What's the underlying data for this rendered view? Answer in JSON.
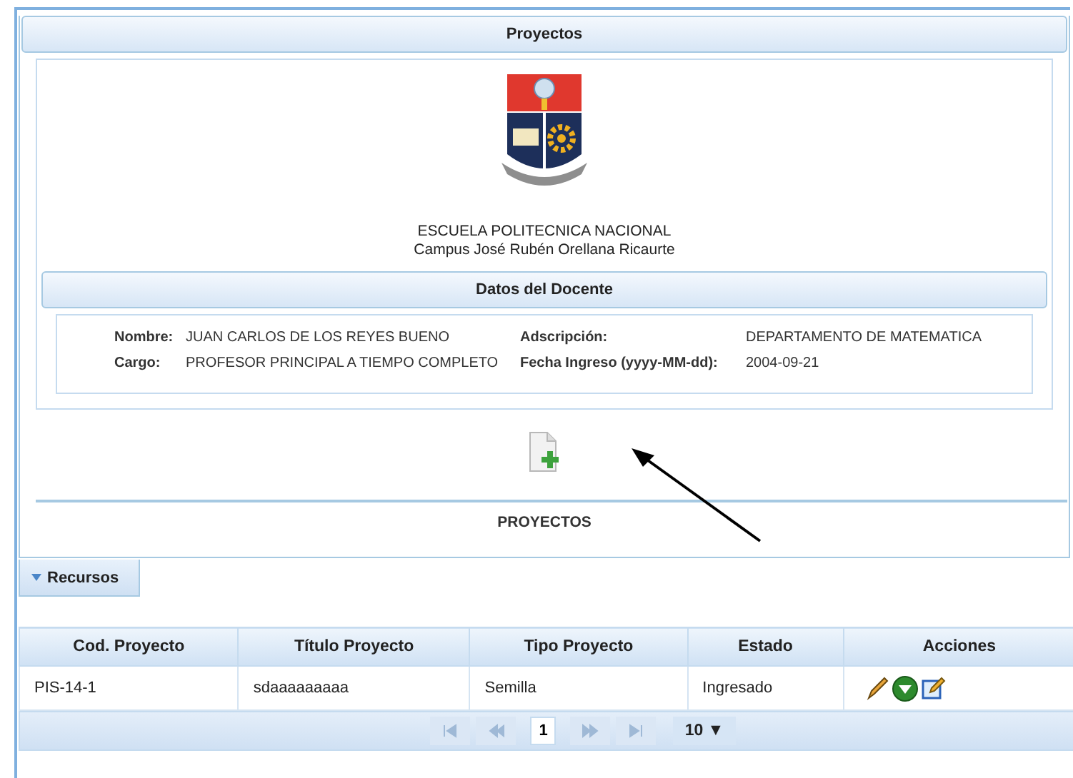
{
  "panel": {
    "title": "Proyectos"
  },
  "institution": {
    "name": "ESCUELA POLITECNICA NACIONAL",
    "campus": "Campus José Rubén Orellana Ricaurte"
  },
  "teacher_section": {
    "title": "Datos del Docente",
    "fields": [
      {
        "label": "Nombre:",
        "value": "JUAN CARLOS DE LOS REYES BUENO"
      },
      {
        "label": "Adscripción:",
        "value": "DEPARTAMENTO DE MATEMATICA"
      },
      {
        "label": "Cargo:",
        "value": "PROFESOR PRINCIPAL A TIEMPO COMPLETO"
      },
      {
        "label": "Fecha Ingreso (yyyy-MM-dd):",
        "value": "2004-09-21"
      }
    ]
  },
  "projects_heading": "PROYECTOS",
  "resources_tab": {
    "label": "Recursos",
    "expanded": true
  },
  "table": {
    "columns": [
      "Cod. Proyecto",
      "Título Proyecto",
      "Tipo Proyecto",
      "Estado",
      "Acciones"
    ],
    "rows": [
      {
        "cells": [
          "PIS-14-1",
          "sdaaaaaaaaa",
          "Semilla",
          "Ingresado"
        ]
      }
    ]
  },
  "pager": {
    "nav": [
      {
        "kind": "first",
        "disabled": true
      },
      {
        "kind": "prev",
        "disabled": true
      },
      {
        "kind": "next",
        "disabled": true
      },
      {
        "kind": "last",
        "disabled": true
      }
    ],
    "pages": [
      {
        "label": "1",
        "selected": true
      }
    ],
    "page_size": "10 ▼"
  }
}
